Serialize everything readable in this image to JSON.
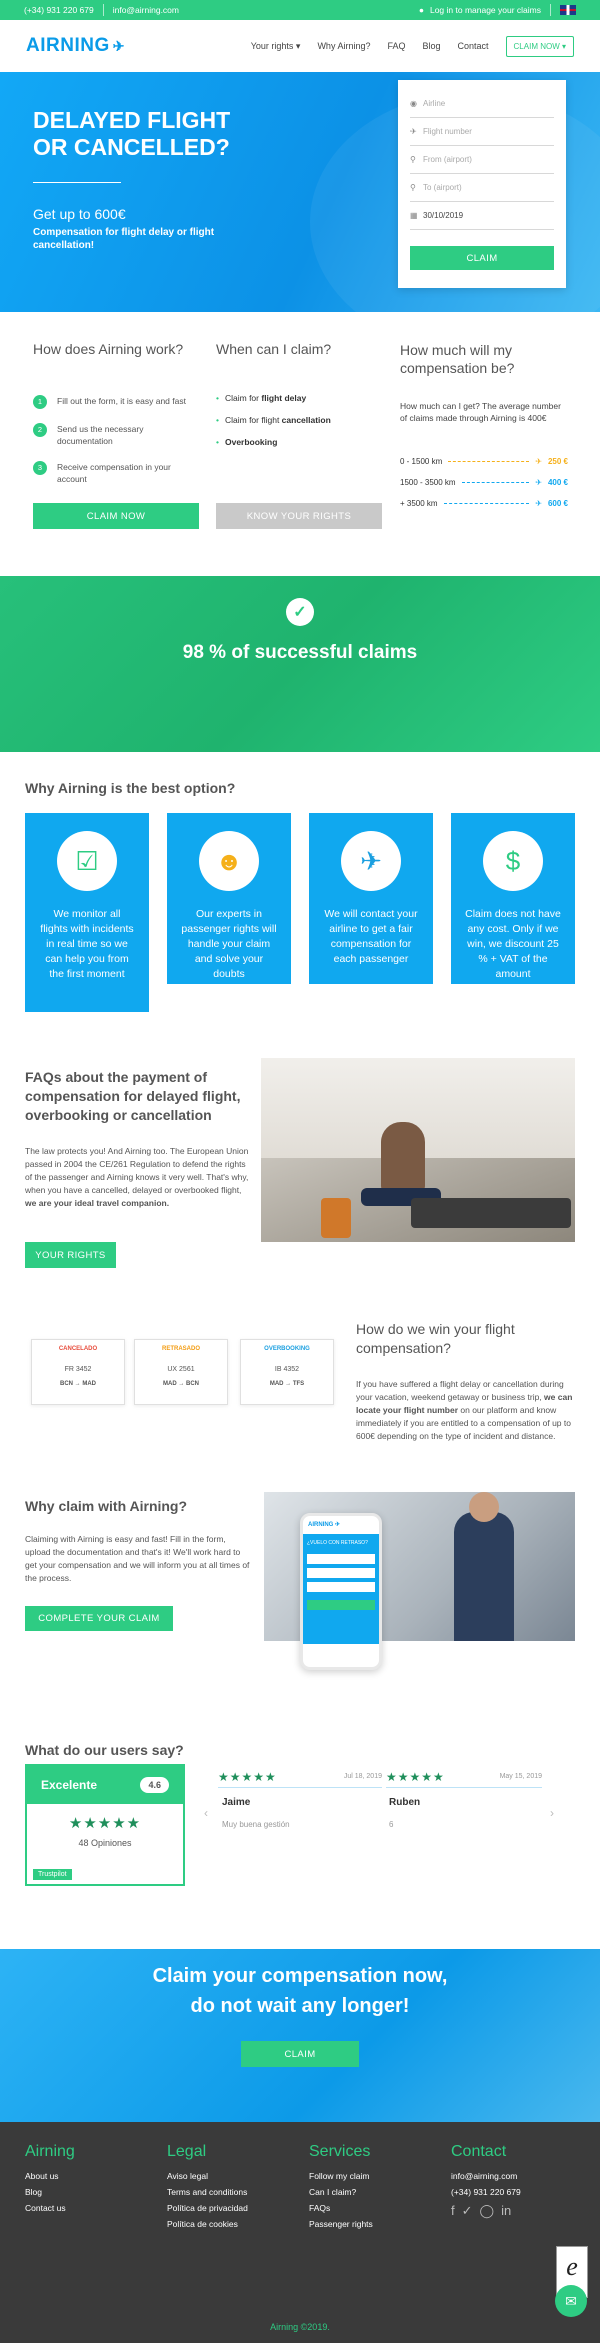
{
  "topbar": {
    "phone": "(+34) 931 220 679",
    "email": "info@airning.com",
    "login": "Log in to manage your claims"
  },
  "nav": {
    "logo": "AIRNING",
    "links": [
      "Your rights ▾",
      "Why Airning?",
      "FAQ",
      "Blog",
      "Contact"
    ],
    "cta": "CLAIM NOW ▾"
  },
  "hero": {
    "title1": "DELAYED FLIGHT",
    "title2": "OR CANCELLED?",
    "amount": "Get up to 600€",
    "sub": "Compensation for flight delay or flight cancellation!"
  },
  "form": {
    "airline": "Airline",
    "flight": "Flight number",
    "from": "From (airport)",
    "to": "To (airport)",
    "date": "30/10/2019",
    "submit": "CLAIM"
  },
  "how": {
    "title": "How does Airning work?",
    "steps": [
      "Fill out the form, it is easy and fast",
      "Send us the necessary documentation",
      "Receive compensation in your account"
    ],
    "button": "CLAIM NOW"
  },
  "when": {
    "title": "When can I claim?",
    "items": [
      [
        "Claim for ",
        "flight delay"
      ],
      [
        "Claim for flight ",
        "cancellation"
      ],
      [
        "",
        "Overbooking"
      ]
    ],
    "button": "KNOW YOUR RIGHTS"
  },
  "much": {
    "title": "How much will my compensation be?",
    "text": "How much can I get? The average number of claims made through Airning is 400€",
    "rows": [
      {
        "km": "0 - 1500 km",
        "eur": "250 €"
      },
      {
        "km": "1500 - 3500 km",
        "eur": "400 €"
      },
      {
        "km": "+ 3500 km",
        "eur": "600 €"
      }
    ]
  },
  "success": {
    "text": "98 % of successful claims"
  },
  "why": {
    "title": "Why Airning is the best option?",
    "cards": [
      "We monitor all flights with incidents in real time so we can help you from the first moment",
      "Our experts in passenger rights will handle your claim and solve your doubts",
      "We will contact your airline to get a fair compensation for each passenger",
      "Claim does not have any cost. Only if we win, we discount 25 % + VAT of the amount"
    ]
  },
  "faq": {
    "title": "FAQs about the payment of compensation for delayed flight, overbooking or cancellation",
    "text": "The law protects you! And Airning too. The European Union passed in 2004 the CE/261 Regulation to defend the rights of the passenger and Airning knows it very well. That's why, when you have a cancelled, delayed or overbooked flight, ",
    "bold": "we are your ideal travel companion.",
    "button": "YOUR RIGHTS"
  },
  "tickets": [
    {
      "status": "CANCELADO",
      "color": "#e74c3c",
      "flight": "FR 3452",
      "route": "BCN → MAD"
    },
    {
      "status": "RETRASADO",
      "color": "#f39c12",
      "flight": "UX 2561",
      "route": "MAD → BCN"
    },
    {
      "status": "OVERBOOKING",
      "color": "#1a9fe0",
      "flight": "IB 4352",
      "route": "MAD → TFS"
    }
  ],
  "win": {
    "title": "How do we win your flight compensation?",
    "text1": "If you have suffered a flight delay or cancellation during your vacation, weekend getaway or business trip, ",
    "bold": "we can locate your flight number",
    "text2": " on our platform and know immediately if you are entitled to a compensation of up to 600€ depending on the type of incident and distance."
  },
  "claimwhy": {
    "title": "Why claim with Airning?",
    "text": "Claiming with Airning is easy and fast! Fill in the form, upload the documentation and that's it! We'll work hard to get your compensation and we will inform you at all times of the process.",
    "button": "COMPLETE YOUR CLAIM",
    "phone_head": "¿VUELO CON RETRASO?"
  },
  "reviews": {
    "title": "What do our users say?",
    "label": "Excelente",
    "score": "4.6",
    "count": "48 Opiniones",
    "brand": "Trustpilot",
    "items": [
      {
        "date": "Jul 18, 2019",
        "name": "Jaime",
        "text": "Muy buena gestión"
      },
      {
        "date": "May 15, 2019",
        "name": "Ruben",
        "text": "6"
      }
    ]
  },
  "cta": {
    "line1": "Claim your compensation now,",
    "line2": "do not wait any longer!",
    "button": "CLAIM"
  },
  "footer": {
    "cols": [
      {
        "title": "Airning",
        "items": [
          "About us",
          "Blog",
          "Contact us"
        ]
      },
      {
        "title": "Legal",
        "items": [
          "Aviso legal",
          "Terms and conditions",
          "Política de privacidad",
          "Política de cookies"
        ]
      },
      {
        "title": "Services",
        "items": [
          "Follow my claim",
          "Can I claim?",
          "FAQs",
          "Passenger rights"
        ]
      },
      {
        "title": "Contact",
        "items": [
          "info@airning.com",
          "(+34) 931 220 679"
        ]
      }
    ],
    "copy": "Airning ©2019."
  },
  "colors": {
    "green": "#2ecc83",
    "blue": "#10a8ef",
    "yellow": "#f5b01a"
  }
}
